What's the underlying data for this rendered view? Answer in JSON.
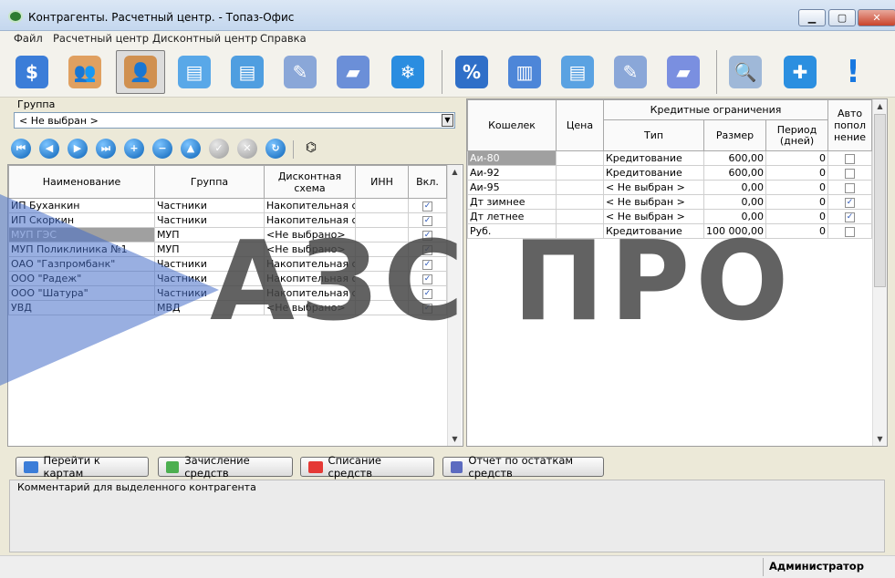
{
  "window": {
    "title": "Контрагенты. Расчетный центр. - Топаз-Офис",
    "minimize": "▁",
    "maximize": "▢",
    "close": "✕"
  },
  "menu": [
    "Файл",
    "Расчетный центр",
    "Дисконтный центр",
    "Справка"
  ],
  "toolbar_icons": [
    "money-bag-icon",
    "users-group-icon",
    "users-pair-icon",
    "cards-icon",
    "cards-stack-icon",
    "document-edit-icon",
    "book-icon",
    "snowflake-icon",
    "discount-book-icon",
    "card-file-icon",
    "cards-blue-icon",
    "notepad-icon",
    "folder-book-icon",
    "search-doc-icon",
    "puzzle-icon",
    "exclamation-icon"
  ],
  "group": {
    "label": "Группа",
    "value": "< Не выбран >"
  },
  "nav_buttons": [
    "first",
    "prev",
    "next",
    "last",
    "add",
    "delete",
    "up",
    "apply",
    "cancel",
    "refresh",
    "find"
  ],
  "left_table": {
    "headers": [
      "Наименование",
      "Группа",
      "Дисконтная схема",
      "ИНН",
      "Вкл."
    ],
    "rows": [
      {
        "name": "ИП Буханкин",
        "group": "Частники",
        "scheme": "Накопительная ски",
        "inn": "",
        "on": "✓"
      },
      {
        "name": "ИП Скоркин",
        "group": "Частники",
        "scheme": "Накопительная ски",
        "inn": "",
        "on": "✓"
      },
      {
        "name": "МУП ГЭС",
        "group": "МУП",
        "scheme": "<Не выбрано>",
        "inn": "",
        "on": "✓"
      },
      {
        "name": "МУП Поликлиника №1",
        "group": "МУП",
        "scheme": "<Не выбрано>",
        "inn": "",
        "on": "✓"
      },
      {
        "name": "ОАО \"Газпромбанк\"",
        "group": "Частники",
        "scheme": "Накопительная ски",
        "inn": "",
        "on": "✓"
      },
      {
        "name": "ООО \"Радеж\"",
        "group": "Частники",
        "scheme": "Накопительная ски",
        "inn": "",
        "on": "✓"
      },
      {
        "name": "ООО \"Шатура\"",
        "group": "Частники",
        "scheme": "Накопительная ски",
        "inn": "",
        "on": "✓"
      },
      {
        "name": "УВД",
        "group": "МВД",
        "scheme": "<Не выбрано>",
        "inn": "",
        "on": "✓"
      }
    ]
  },
  "right_table": {
    "headers": {
      "wallet": "Кошелек",
      "price": "Цена",
      "credit": "Кредитные ограничения",
      "type": "Тип",
      "size": "Размер",
      "period": "Период (дней)",
      "auto": "Авто попол нение"
    },
    "rows": [
      {
        "wallet": "Аи-80",
        "price": "",
        "type": "Кредитование",
        "size": "600,00",
        "period": "0",
        "auto": ""
      },
      {
        "wallet": "Аи-92",
        "price": "",
        "type": "Кредитование",
        "size": "600,00",
        "period": "0",
        "auto": ""
      },
      {
        "wallet": "Аи-95",
        "price": "",
        "type": "< Не выбран >",
        "size": "0,00",
        "period": "0",
        "auto": ""
      },
      {
        "wallet": "Дт зимнее",
        "price": "",
        "type": "< Не выбран >",
        "size": "0,00",
        "period": "0",
        "auto": "✓"
      },
      {
        "wallet": "Дт летнее",
        "price": "",
        "type": "< Не выбран >",
        "size": "0,00",
        "period": "0",
        "auto": "✓"
      },
      {
        "wallet": "Руб.",
        "price": "",
        "type": "Кредитование",
        "size": "100 000,00",
        "period": "0",
        "auto": ""
      }
    ]
  },
  "buttons": {
    "to_cards": "Перейти к картам",
    "credit": "Зачисление средств",
    "debit": "Списание средств",
    "report": "Отчет по остаткам средств"
  },
  "comment_label": "Комментарий для выделенного контрагента",
  "status_user": "Администратор",
  "watermark": "АЗС ПРО",
  "colors": {
    "selected_row": "#a0a0a0",
    "link_blue": "#0b63b8"
  }
}
